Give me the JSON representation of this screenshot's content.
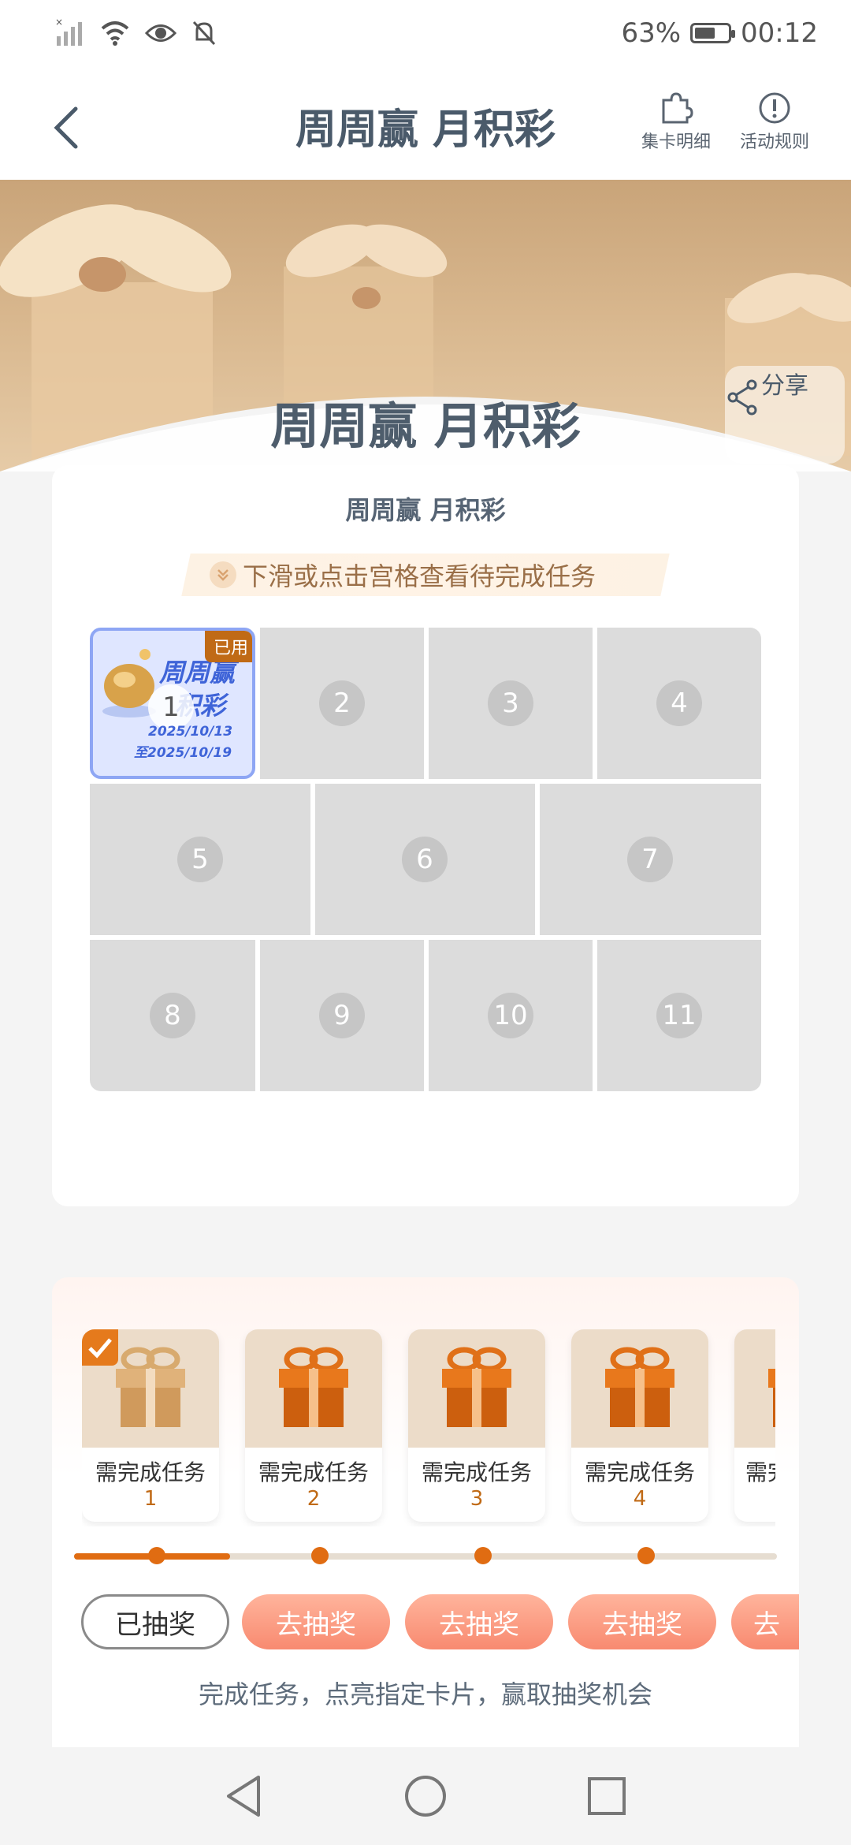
{
  "status_bar": {
    "battery": "63%",
    "time": "00:12",
    "battery_level": 0.63
  },
  "header": {
    "title": "周周赢 月积彩",
    "card_detail_label": "集卡明细",
    "rules_label": "活动规则"
  },
  "banner": {
    "share_label": "分享",
    "big_title": "周周赢 月积彩"
  },
  "card_section": {
    "title": "周周赢 月积彩",
    "hint": "下滑或点击宫格查看待完成任务",
    "first_card": {
      "number": "1",
      "badge": "已用",
      "title_line1": "周周赢",
      "title_line2": "积彩",
      "date_line1": "2025/10/13",
      "date_line2": "至2025/10/19"
    },
    "cells": [
      "2",
      "3",
      "4",
      "5",
      "6",
      "7",
      "8",
      "9",
      "10",
      "11"
    ]
  },
  "rewards_section": {
    "items": [
      {
        "label": "需完成任务",
        "count": "1",
        "checked": true
      },
      {
        "label": "需完成任务",
        "count": "2",
        "checked": false
      },
      {
        "label": "需完成任务",
        "count": "3",
        "checked": false
      },
      {
        "label": "需完成任务",
        "count": "4",
        "checked": false
      },
      {
        "label": "需完",
        "count": "",
        "checked": false
      }
    ],
    "buttons": [
      "已抽奖",
      "去抽奖",
      "去抽奖",
      "去抽奖",
      "去"
    ],
    "footer": "完成任务，点亮指定卡片，赢取抽奖机会",
    "colors": {
      "accent": "#e06c12",
      "go_button": "#f88a70"
    }
  }
}
